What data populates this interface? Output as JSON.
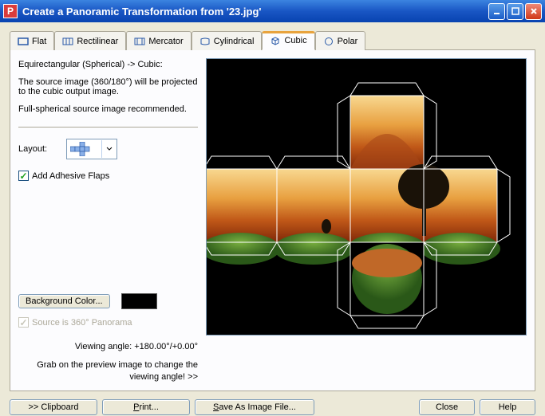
{
  "window": {
    "title": "Create a Panoramic Transformation from '23.jpg'"
  },
  "tabs": [
    {
      "label": "Flat"
    },
    {
      "label": "Rectilinear"
    },
    {
      "label": "Mercator"
    },
    {
      "label": "Cylindrical"
    },
    {
      "label": "Cubic"
    },
    {
      "label": "Polar"
    }
  ],
  "left": {
    "heading": "Equirectangular (Spherical) -> Cubic:",
    "desc": "The source image (360/180°) will be projected to the cubic output image.",
    "note": "Full-spherical source image recommended.",
    "layout_label": "Layout:",
    "add_flaps_label": "Add Adhesive Flaps",
    "add_flaps_checked": true,
    "bg_button": "Background Color...",
    "bg_color": "#000000",
    "source360_label": "Source is 360° Panorama",
    "source360_checked": true,
    "viewing_angle": "Viewing angle: +180.00°/+0.00°",
    "hint": "Grab on the preview image to change the viewing angle!  >>"
  },
  "buttons": {
    "clipboard": ">> Clipboard",
    "print": "Print...",
    "save": "Save As Image File...",
    "close": "Close",
    "help": "Help"
  }
}
